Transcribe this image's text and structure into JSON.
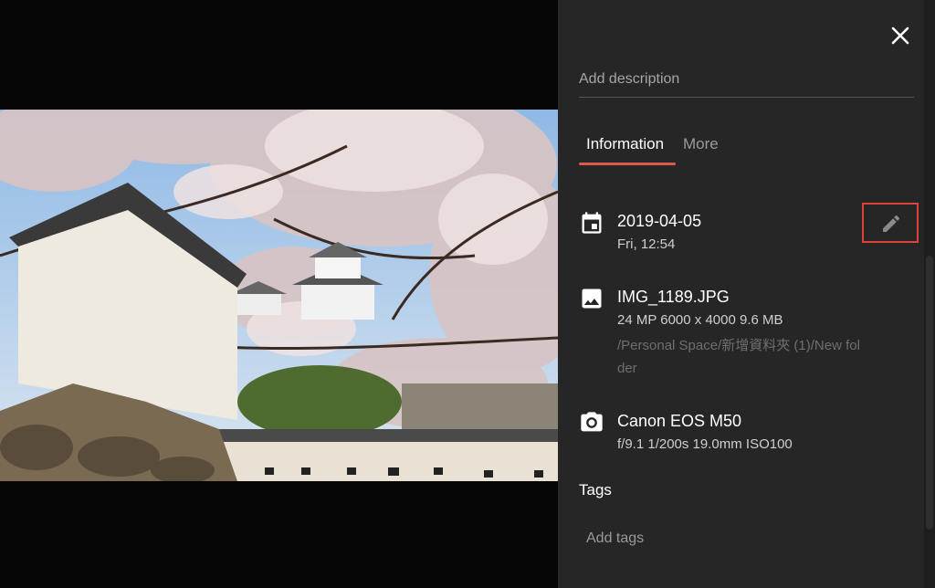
{
  "viewer": {
    "photo_alt": "Castle with cherry blossoms"
  },
  "panel": {
    "close_icon": "close-icon",
    "description_placeholder": "Add description",
    "tabs": [
      {
        "label": "Information",
        "active": true
      },
      {
        "label": "More",
        "active": false
      }
    ],
    "date": {
      "icon": "calendar-icon",
      "date": "2019-04-05",
      "time": "Fri, 12:54",
      "edit_icon": "pencil-icon"
    },
    "file": {
      "icon": "image-icon",
      "name": "IMG_1189.JPG",
      "details": "24 MP  6000 x 4000  9.6 MB",
      "path": "/Personal Space/新增資料夾 (1)/New folder"
    },
    "camera": {
      "icon": "camera-icon",
      "model": "Canon EOS M50",
      "settings": "f/9.1  1/200s  19.0mm  ISO100"
    },
    "tags_label": "Tags",
    "tags_placeholder": "Add tags"
  },
  "colors": {
    "panel_bg": "#262626",
    "accent": "#e0574b",
    "highlight_border": "#d9453b"
  }
}
